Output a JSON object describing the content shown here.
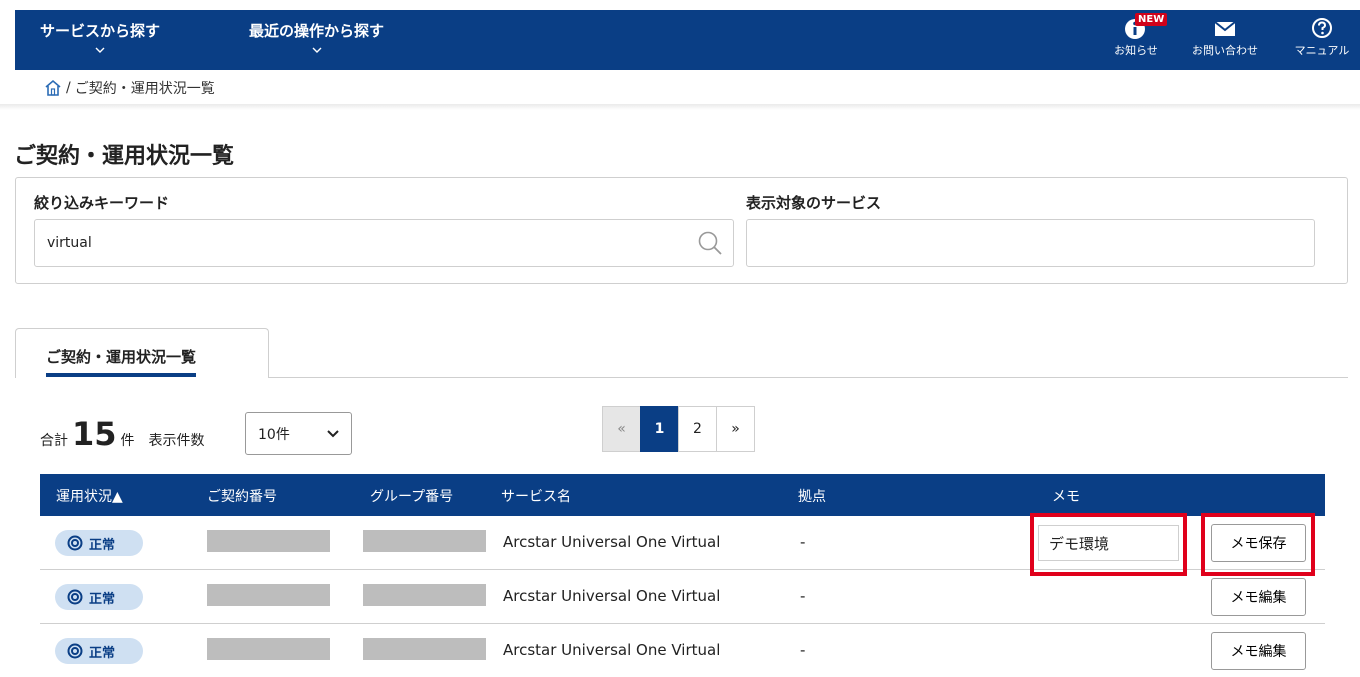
{
  "nav": {
    "menu_services": "サービスから探す",
    "menu_recent": "最近の操作から探す",
    "news_badge": "NEW",
    "news": "お知らせ",
    "contact": "お問い合わせ",
    "manual": "マニュアル"
  },
  "breadcrumb": {
    "current": "ご契約・運用状況一覧"
  },
  "page": {
    "title": "ご契約・運用状況一覧"
  },
  "filter": {
    "keyword_label": "絞り込みキーワード",
    "keyword_value": "virtual",
    "service_label": "表示対象のサービス",
    "service_value": ""
  },
  "tab": {
    "label": "ご契約・運用状況一覧"
  },
  "summary": {
    "total_prefix": "合計",
    "total_count": "15",
    "total_suffix": "件",
    "per_page_label": "表示件数",
    "per_page_value": "10件"
  },
  "pagination": {
    "prev": "«",
    "pages": [
      "1",
      "2"
    ],
    "current": "1",
    "next": "»"
  },
  "table": {
    "headers": [
      "運用状況▲",
      "ご契約番号",
      "グループ番号",
      "サービス名",
      "拠点",
      "メモ"
    ],
    "rows": [
      {
        "status": "正常",
        "service": "Arcstar Universal One Virtual",
        "site": "-",
        "memo": "デモ環境",
        "button": "メモ保存"
      },
      {
        "status": "正常",
        "service": "Arcstar Universal One Virtual",
        "site": "-",
        "memo": "",
        "button": "メモ編集"
      },
      {
        "status": "正常",
        "service": "Arcstar Universal One Virtual",
        "site": "-",
        "memo": "",
        "button": "メモ編集"
      }
    ]
  },
  "colors": {
    "brand": "#0a3e85",
    "highlight": "#e0001b",
    "status_bg": "#cfe0f2"
  }
}
